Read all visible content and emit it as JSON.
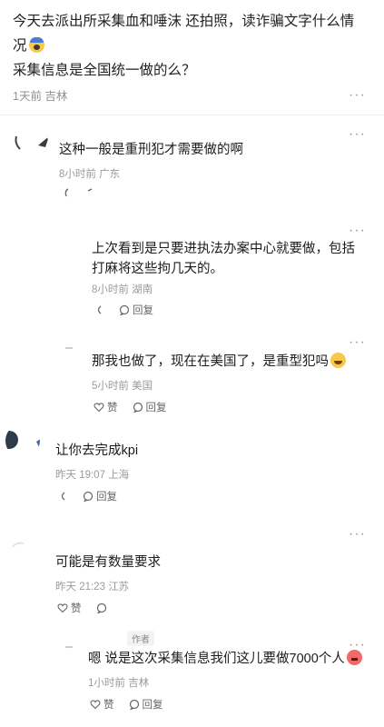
{
  "post": {
    "line1": "今天去派出所采集血和唾沫 还拍照，读诈骗文字什么情",
    "line2": "况",
    "line3": "采集信息是全国统一做的么？",
    "time_location": "1天前 吉林",
    "more": "···"
  },
  "comments": [
    {
      "text": "这种一般是重刑犯才需要做的啊",
      "time": "8小时前",
      "location": "广东",
      "like_label": "",
      "reply_label": ""
    },
    {
      "text": "上次看到是只要进执法办案中心就要做，包括打麻将这些拘几天的。",
      "time": "8小时前",
      "location": "湖南",
      "reply_label": "回复"
    },
    {
      "text": "那我也做了，现在在美国了，是重型犯吗",
      "time": "5小时前",
      "location": "美国",
      "like_label": "赞",
      "reply_label": "回复"
    },
    {
      "text": "让你去完成kpi",
      "time": "昨天 19:07",
      "location": "上海",
      "reply_label": "回复"
    },
    {
      "text": "可能是有数量要求",
      "time": "昨天 21:23",
      "location": "江苏",
      "like_label": "赞"
    },
    {
      "author_badge": "作者",
      "text": "嗯 说是这次采集信息我们这儿要做7000个人",
      "time": "1小时前",
      "location": "吉林",
      "like_label": "赞",
      "reply_label": "回复"
    }
  ],
  "colors": {
    "text": "#1c1c1c",
    "meta": "#9a9a9a",
    "divider": "#f0f0f0",
    "emoji": "#f7c948"
  }
}
